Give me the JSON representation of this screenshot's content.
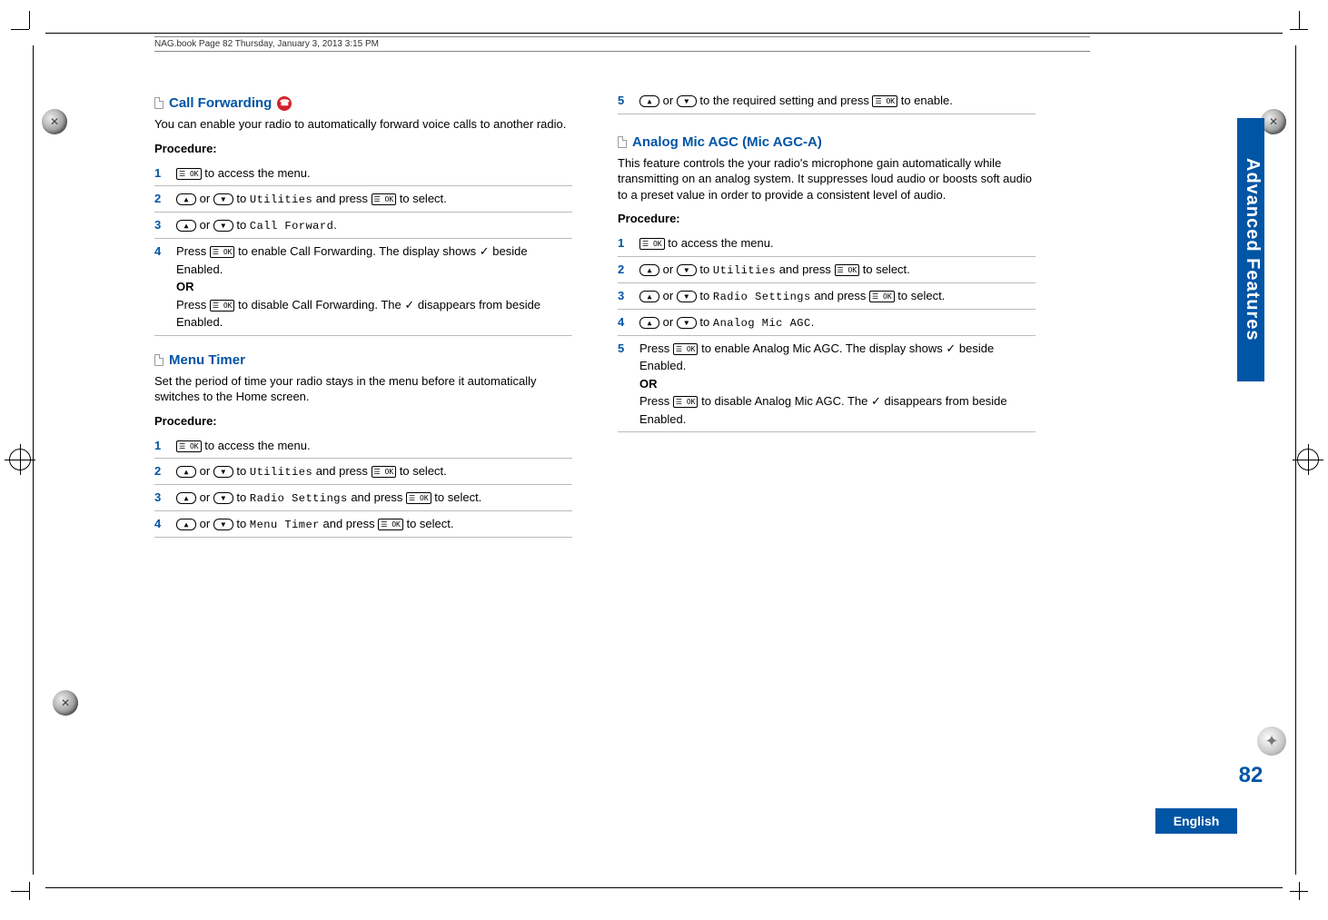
{
  "header": "NAG.book  Page 82  Thursday, January 3, 2013  3:15 PM",
  "side_tab": "Advanced Features",
  "page_number": "82",
  "language": "English",
  "icons": {
    "ok": "☰ OK",
    "up": "▲",
    "down": "▼",
    "check": "✓"
  },
  "left": {
    "s1": {
      "title": "Call Forwarding",
      "intro": "You can enable your radio to automatically forward voice calls to another radio.",
      "proc": "Procedure:",
      "steps": {
        "n1": "1",
        "t1a": " to access the menu.",
        "n2": "2",
        "t2a": " or ",
        "t2b": " to ",
        "t2menu": "Utilities",
        "t2c": " and press ",
        "t2d": " to select.",
        "n3": "3",
        "t3a": " or ",
        "t3b": " to ",
        "t3menu": "Call Forward",
        "t3c": ".",
        "n4": "4",
        "t4a": "Press ",
        "t4b": " to enable Call Forwarding. The display shows ",
        "t4c": " beside Enabled.",
        "t4or": "OR",
        "t4d": "Press ",
        "t4e": " to disable Call Forwarding. The ",
        "t4f": " disappears from beside Enabled."
      }
    },
    "s2": {
      "title": "Menu Timer",
      "intro": "Set the period of time your radio stays in the menu before it automatically switches to the Home screen.",
      "proc": "Procedure:",
      "steps": {
        "n1": "1",
        "t1a": " to access the menu.",
        "n2": "2",
        "t2a": " or ",
        "t2b": " to ",
        "t2menu": "Utilities",
        "t2c": " and press ",
        "t2d": " to select.",
        "n3": "3",
        "t3a": " or ",
        "t3b": " to ",
        "t3menu": "Radio Settings",
        "t3c": " and press ",
        "t3d": " to select.",
        "n4": "4",
        "t4a": " or ",
        "t4b": " to ",
        "t4menu": "Menu Timer",
        "t4c": " and press ",
        "t4d": " to select."
      }
    }
  },
  "right": {
    "cont": {
      "n5": "5",
      "t5a": " or ",
      "t5b": " to the required setting and press ",
      "t5c": " to enable."
    },
    "s3": {
      "title": "Analog Mic AGC (Mic AGC-A)",
      "intro": "This feature controls the your radio's microphone gain automatically while transmitting on an analog system. It suppresses loud audio or boosts soft audio to a preset value in order to provide a consistent level of audio.",
      "proc": "Procedure:",
      "steps": {
        "n1": "1",
        "t1a": " to access the menu.",
        "n2": "2",
        "t2a": " or ",
        "t2b": " to ",
        "t2menu": "Utilities",
        "t2c": " and press ",
        "t2d": " to select.",
        "n3": "3",
        "t3a": " or ",
        "t3b": " to ",
        "t3menu": "Radio Settings",
        "t3c": " and press ",
        "t3d": " to select.",
        "n4": "4",
        "t4a": " or ",
        "t4b": " to ",
        "t4menu": "Analog Mic AGC",
        "t4c": ".",
        "n5": "5",
        "t5a": "Press ",
        "t5b": " to enable Analog Mic AGC. The display shows ",
        "t5c": " beside Enabled.",
        "t5or": "OR",
        "t5d": "Press ",
        "t5e": " to disable Analog Mic AGC. The ",
        "t5f": " disappears from beside Enabled."
      }
    }
  }
}
